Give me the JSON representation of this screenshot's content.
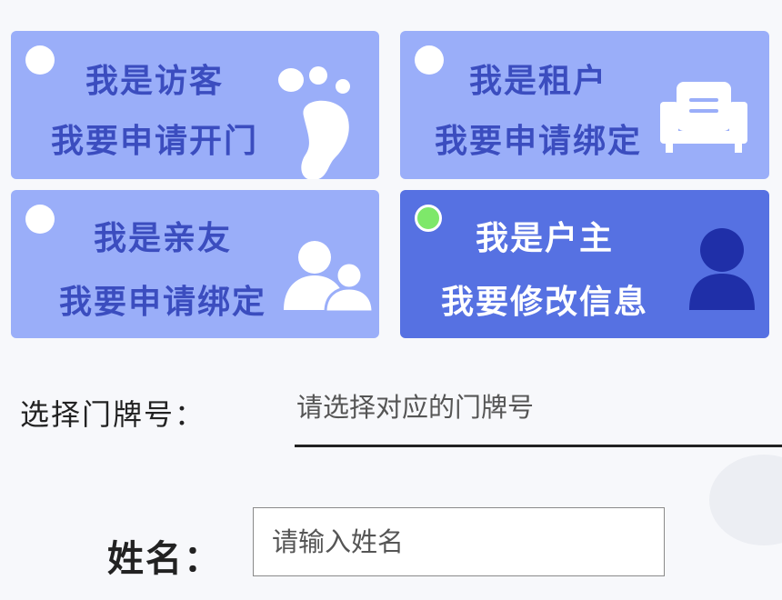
{
  "colors": {
    "card_bg": "#9aaef9",
    "card_selected_bg": "#5671e2",
    "card_text": "#3b4dbf",
    "card_selected_text": "#ffffff",
    "radio_on": "#7ee86a"
  },
  "roles": [
    {
      "line1": "我是访客",
      "line2": "我要申请开门",
      "icon": "footprint-icon",
      "selected": false
    },
    {
      "line1": "我是租户",
      "line2": "我要申请绑定",
      "icon": "sofa-icon",
      "selected": false
    },
    {
      "line1": "我是亲友",
      "line2": "我要申请绑定",
      "icon": "people-icon",
      "selected": false
    },
    {
      "line1": "我是户主",
      "line2": "我要修改信息",
      "icon": "person-icon",
      "selected": true
    }
  ],
  "form": {
    "door_label": "选择门牌号：",
    "door_placeholder": "请选择对应的门牌号",
    "name_label": "姓名：",
    "name_placeholder": "请输入姓名"
  }
}
